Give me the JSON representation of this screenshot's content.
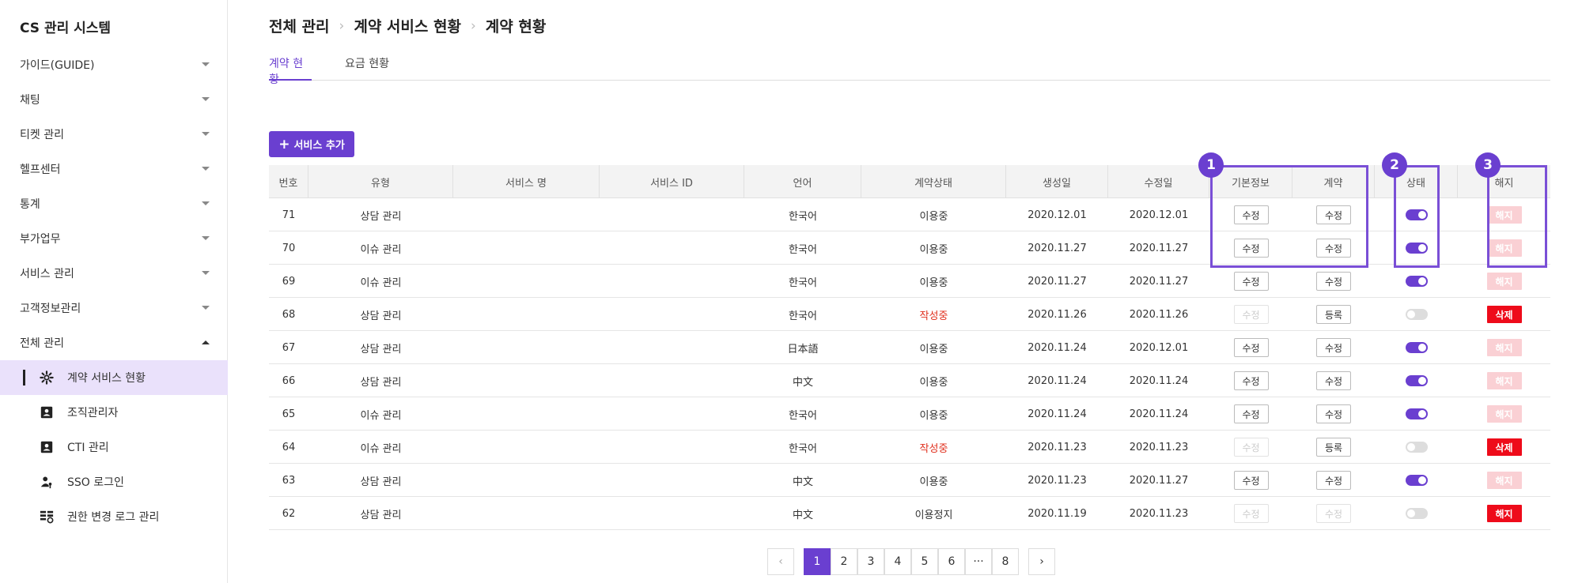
{
  "app": {
    "title": "CS 관리 시스템"
  },
  "sidebar": {
    "items": [
      {
        "label": "가이드(GUIDE)"
      },
      {
        "label": "채팅"
      },
      {
        "label": "티켓 관리"
      },
      {
        "label": "헬프센터"
      },
      {
        "label": "통계"
      },
      {
        "label": "부가업무"
      },
      {
        "label": "서비스 관리"
      },
      {
        "label": "고객정보관리"
      },
      {
        "label": "전체 관리"
      }
    ],
    "subitems": [
      {
        "label": "계약 서비스 현황",
        "icon": "gear-icon"
      },
      {
        "label": "조직관리자",
        "icon": "user-card-icon"
      },
      {
        "label": "CTI 관리",
        "icon": "user-card-icon"
      },
      {
        "label": "SSO 로그인",
        "icon": "person-key-icon"
      },
      {
        "label": "권한 변경 로그 관리",
        "icon": "log-icon"
      }
    ]
  },
  "breadcrumb": [
    "전체 관리",
    "계약 서비스 현황",
    "계약 현황"
  ],
  "tabs": [
    "계약 현황",
    "요금 현황"
  ],
  "toolbar": {
    "add_label": "서비스 추가",
    "add_icon": "+"
  },
  "table": {
    "headers": [
      "번호",
      "유형",
      "서비스 명",
      "서비스 ID",
      "언어",
      "계약상태",
      "생성일",
      "수정일",
      "기본정보",
      "계약",
      "상태",
      "해지"
    ],
    "rows": [
      {
        "no": "71",
        "type": "상담 관리",
        "name": "",
        "id": "",
        "lang": "한국어",
        "status": "이용중",
        "created": "2020.12.01",
        "modified": "2020.12.01",
        "info": "수정",
        "info_disabled": false,
        "contract": "수정",
        "contract_disabled": false,
        "toggle_on": true,
        "action": "해지",
        "action_style": "faded"
      },
      {
        "no": "70",
        "type": "이슈 관리",
        "name": "",
        "id": "",
        "lang": "한국어",
        "status": "이용중",
        "created": "2020.11.27",
        "modified": "2020.11.27",
        "info": "수정",
        "info_disabled": false,
        "contract": "수정",
        "contract_disabled": false,
        "toggle_on": true,
        "action": "해지",
        "action_style": "faded"
      },
      {
        "no": "69",
        "type": "이슈 관리",
        "name": "",
        "id": "",
        "lang": "한국어",
        "status": "이용중",
        "created": "2020.11.27",
        "modified": "2020.11.27",
        "info": "수정",
        "info_disabled": false,
        "contract": "수정",
        "contract_disabled": false,
        "toggle_on": true,
        "action": "해지",
        "action_style": "faded"
      },
      {
        "no": "68",
        "type": "상담 관리",
        "name": "",
        "id": "",
        "lang": "한국어",
        "status": "작성중",
        "created": "2020.11.26",
        "modified": "2020.11.26",
        "info": "수정",
        "info_disabled": true,
        "contract": "등록",
        "contract_disabled": false,
        "toggle_on": false,
        "action": "삭제",
        "action_style": "solid"
      },
      {
        "no": "67",
        "type": "상담 관리",
        "name": "",
        "id": "",
        "lang": "日本語",
        "status": "이용중",
        "created": "2020.11.24",
        "modified": "2020.12.01",
        "info": "수정",
        "info_disabled": false,
        "contract": "수정",
        "contract_disabled": false,
        "toggle_on": true,
        "action": "해지",
        "action_style": "faded"
      },
      {
        "no": "66",
        "type": "상담 관리",
        "name": "",
        "id": "",
        "lang": "中文",
        "status": "이용중",
        "created": "2020.11.24",
        "modified": "2020.11.24",
        "info": "수정",
        "info_disabled": false,
        "contract": "수정",
        "contract_disabled": false,
        "toggle_on": true,
        "action": "해지",
        "action_style": "faded"
      },
      {
        "no": "65",
        "type": "이슈 관리",
        "name": "",
        "id": "",
        "lang": "한국어",
        "status": "이용중",
        "created": "2020.11.24",
        "modified": "2020.11.24",
        "info": "수정",
        "info_disabled": false,
        "contract": "수정",
        "contract_disabled": false,
        "toggle_on": true,
        "action": "해지",
        "action_style": "faded"
      },
      {
        "no": "64",
        "type": "이슈 관리",
        "name": "",
        "id": "",
        "lang": "한국어",
        "status": "작성중",
        "created": "2020.11.23",
        "modified": "2020.11.23",
        "info": "수정",
        "info_disabled": true,
        "contract": "등록",
        "contract_disabled": false,
        "toggle_on": false,
        "action": "삭제",
        "action_style": "solid"
      },
      {
        "no": "63",
        "type": "상담 관리",
        "name": "",
        "id": "",
        "lang": "中文",
        "status": "이용중",
        "created": "2020.11.23",
        "modified": "2020.11.27",
        "info": "수정",
        "info_disabled": false,
        "contract": "수정",
        "contract_disabled": false,
        "toggle_on": true,
        "action": "해지",
        "action_style": "faded"
      },
      {
        "no": "62",
        "type": "상담 관리",
        "name": "",
        "id": "",
        "lang": "中文",
        "status": "이용정지",
        "created": "2020.11.19",
        "modified": "2020.11.23",
        "info": "수정",
        "info_disabled": true,
        "contract": "수정",
        "contract_disabled": true,
        "toggle_on": false,
        "action": "해지",
        "action_style": "solid"
      }
    ]
  },
  "annotations": [
    "1",
    "2",
    "3"
  ],
  "pagination": {
    "prev": "‹",
    "next": "›",
    "pages": [
      "1",
      "2",
      "3",
      "4",
      "5",
      "6",
      "···",
      "8"
    ],
    "active": "1"
  },
  "colors": {
    "accent": "#6a3fd0",
    "danger": "#ee0b1a",
    "danger_faded": "#fad0d4",
    "status_red": "#e0301e"
  }
}
